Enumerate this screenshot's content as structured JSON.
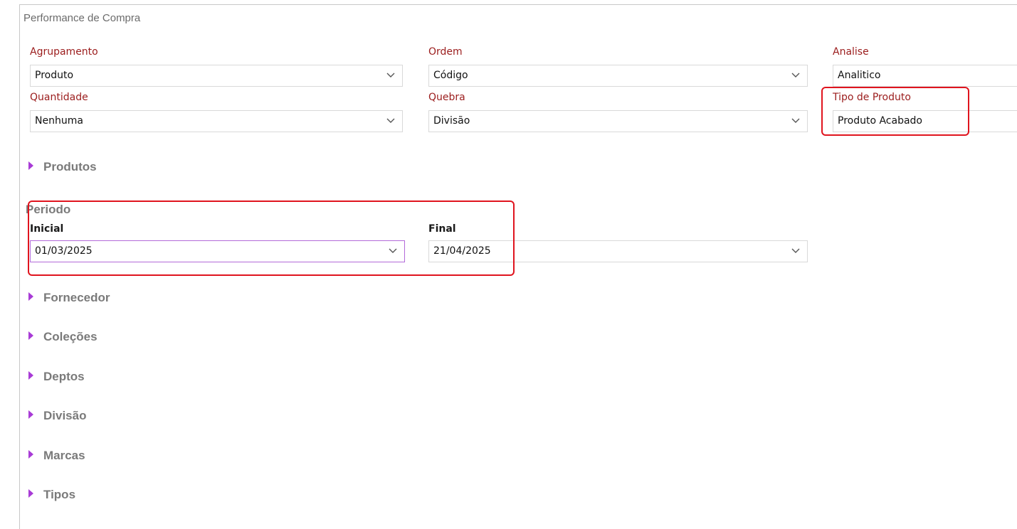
{
  "window": {
    "title": "Performance de Compra"
  },
  "filters": {
    "agrupamento": {
      "label": "Agrupamento",
      "value": "Produto"
    },
    "ordem": {
      "label": "Ordem",
      "value": "Código"
    },
    "analise": {
      "label": "Analise",
      "value": "Analitico"
    },
    "quantidade": {
      "label": "Quantidade",
      "value": "Nenhuma"
    },
    "quebra": {
      "label": "Quebra",
      "value": "Divisão"
    },
    "tipo_produto": {
      "label": "Tipo de Produto",
      "value": "Produto Acabado"
    }
  },
  "periodo": {
    "title": "Periodo",
    "inicial": {
      "label": "Inicial",
      "value": "01/03/2025"
    },
    "final": {
      "label": "Final",
      "value": "21/04/2025"
    }
  },
  "sections": {
    "produtos": "Produtos",
    "fornecedor": "Fornecedor",
    "colecoes": "Coleções",
    "deptos": "Deptos",
    "divisao": "Divisão",
    "marcas": "Marcas",
    "tipos": "Tipos"
  },
  "colors": {
    "label_red": "#9b1c1c",
    "highlight_red": "#e0141e",
    "accent_purple": "#a83bd6",
    "focus_border": "#b36ad9"
  },
  "icons": {
    "dropdown": "chevron-down-icon",
    "expand": "caret-right-icon"
  }
}
